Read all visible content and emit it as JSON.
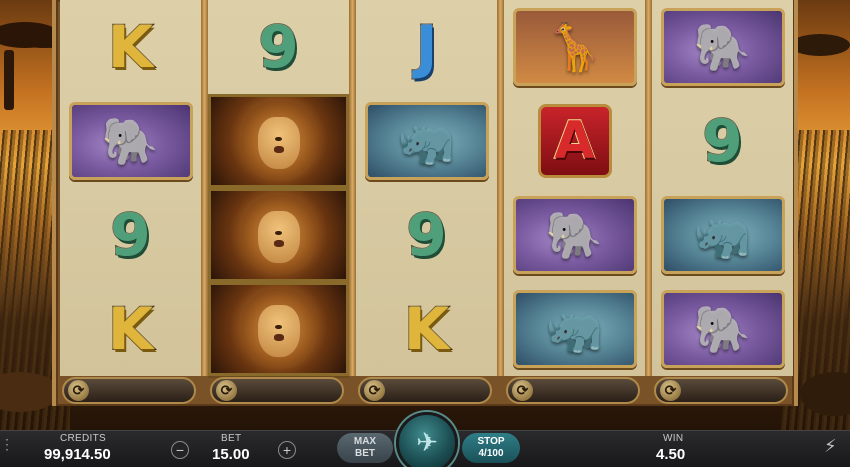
{
  "reels": [
    {
      "symbols": [
        {
          "kind": "letter",
          "text": "K",
          "style": "k",
          "name": "symbol-k"
        },
        {
          "kind": "animal",
          "animal": "elephant",
          "icon": "elephant-icon",
          "name": "symbol-elephant"
        },
        {
          "kind": "letter",
          "text": "9",
          "style": "n9",
          "name": "symbol-9"
        },
        {
          "kind": "letter",
          "text": "K",
          "style": "k",
          "name": "symbol-k"
        }
      ]
    },
    {
      "symbols": [
        {
          "kind": "letter",
          "text": "9",
          "style": "n9",
          "name": "symbol-9"
        },
        {
          "kind": "lion",
          "icon": "lion-icon",
          "name": "symbol-lion"
        },
        {
          "kind": "lion",
          "icon": "lion-icon",
          "name": "symbol-lion"
        },
        {
          "kind": "lion",
          "icon": "lion-icon",
          "name": "symbol-lion"
        }
      ]
    },
    {
      "symbols": [
        {
          "kind": "letter",
          "text": "J",
          "style": "j",
          "name": "symbol-j"
        },
        {
          "kind": "animal",
          "animal": "rhino",
          "icon": "rhino-icon",
          "name": "symbol-rhino"
        },
        {
          "kind": "letter",
          "text": "9",
          "style": "n9",
          "name": "symbol-9"
        },
        {
          "kind": "letter",
          "text": "K",
          "style": "k",
          "name": "symbol-k"
        }
      ]
    },
    {
      "symbols": [
        {
          "kind": "animal",
          "animal": "giraffe",
          "icon": "giraffe-icon",
          "name": "symbol-giraffe"
        },
        {
          "kind": "letter-box",
          "text": "A",
          "style": "a",
          "name": "symbol-a"
        },
        {
          "kind": "animal",
          "animal": "elephant",
          "icon": "elephant-icon",
          "name": "symbol-elephant"
        },
        {
          "kind": "animal",
          "animal": "rhino",
          "icon": "rhino-icon",
          "name": "symbol-rhino"
        }
      ]
    },
    {
      "symbols": [
        {
          "kind": "animal",
          "animal": "elephant",
          "icon": "elephant-icon",
          "name": "symbol-elephant"
        },
        {
          "kind": "letter",
          "text": "9",
          "style": "n9",
          "name": "symbol-9"
        },
        {
          "kind": "animal",
          "animal": "rhino",
          "icon": "rhino-icon",
          "name": "symbol-rhino"
        },
        {
          "kind": "animal",
          "animal": "elephant",
          "icon": "elephant-icon",
          "name": "symbol-elephant"
        }
      ]
    }
  ],
  "reel_spin_icon": "refresh-icon",
  "controls": {
    "credits_label": "CREDITS",
    "credits_value": "99,914.50",
    "bet_label": "BET",
    "bet_value": "15.00",
    "bet_decrease": "−",
    "bet_increase": "+",
    "max_bet_line1": "MAX",
    "max_bet_line2": "BET",
    "stop_line1": "STOP",
    "stop_line2": "4/100",
    "win_label": "WIN",
    "win_value": "4.50"
  },
  "icons": {
    "spin": "spin-logo-icon",
    "turbo": "lightning-bolt-icon"
  },
  "colors": {
    "bar_bg": "#1f1f21",
    "stop_button": "#2a6f78",
    "max_bet_button": "#4a575e",
    "reel_bg": "#d8caa2",
    "reel_divider": "#c9a25a"
  }
}
